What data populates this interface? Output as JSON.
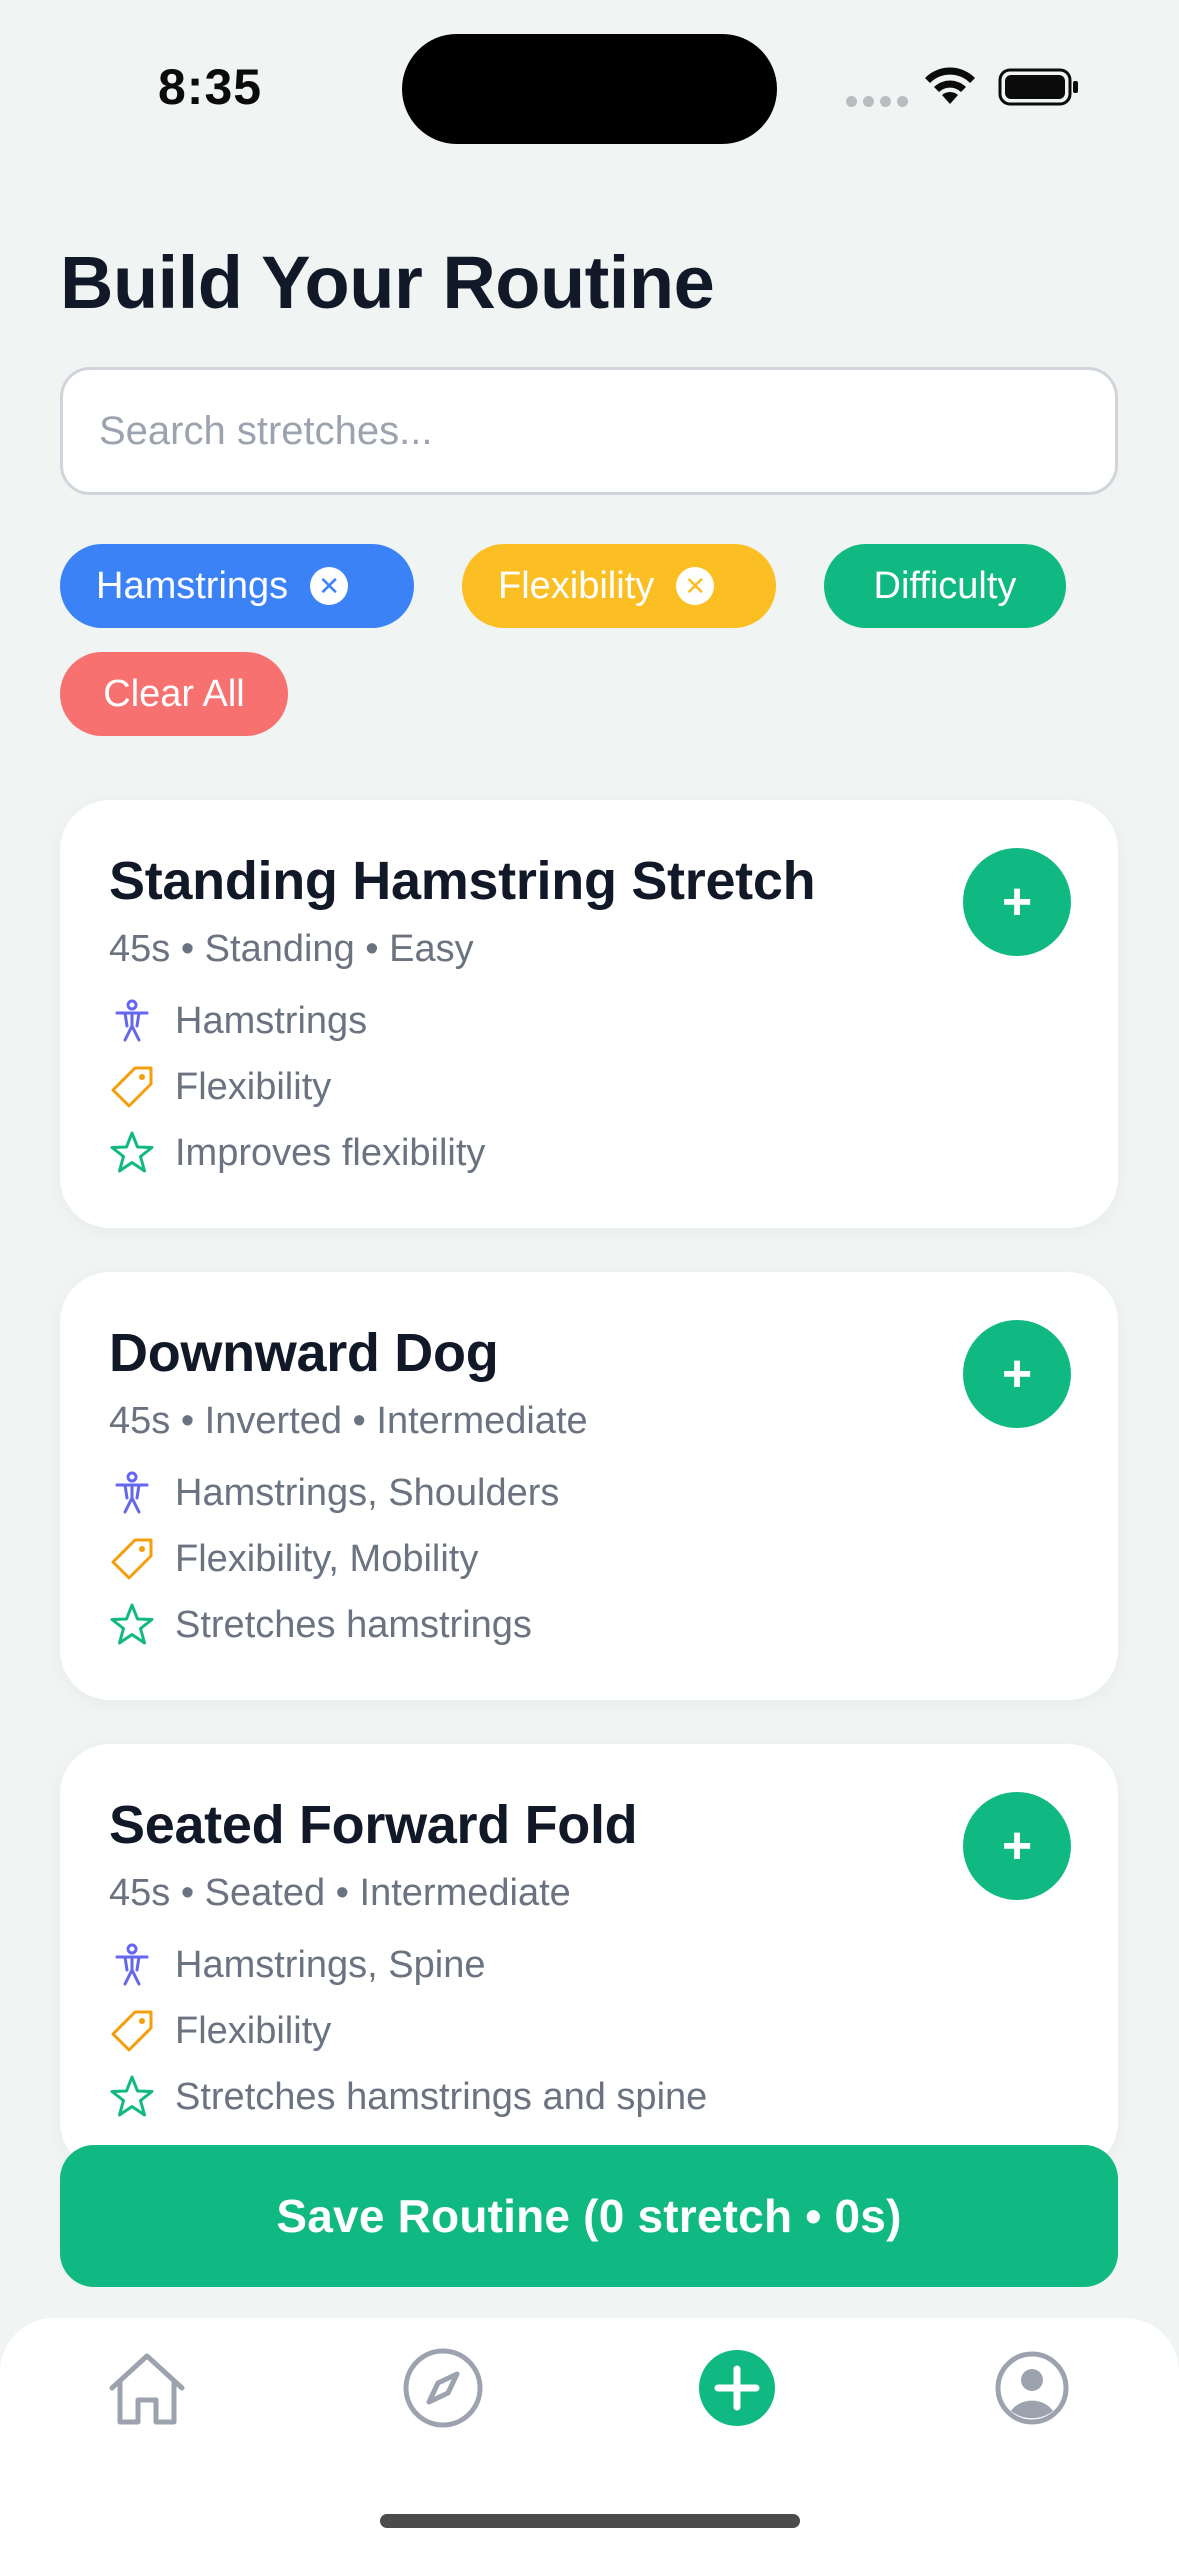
{
  "status_bar": {
    "time": "8:35"
  },
  "page": {
    "title": "Build Your Routine"
  },
  "search": {
    "placeholder": "Search stretches...",
    "value": ""
  },
  "filters": {
    "chips": [
      {
        "label": "Hamstrings",
        "color": "#3b82f6",
        "removable": true
      },
      {
        "label": "Flexibility",
        "color": "#fbbf24",
        "removable": true
      },
      {
        "label": "Difficulty",
        "color": "#10b981",
        "removable": false
      }
    ],
    "clear_all": {
      "label": "Clear All",
      "color": "#f87171"
    }
  },
  "stretches": [
    {
      "title": "Standing Hamstring Stretch",
      "meta": "45s • Standing • Easy",
      "muscles": "Hamstrings",
      "tags": "Flexibility",
      "benefit": "Improves flexibility",
      "add_label": "+"
    },
    {
      "title": "Downward Dog",
      "meta": "45s • Inverted • Intermediate",
      "muscles": "Hamstrings, Shoulders",
      "tags": "Flexibility, Mobility",
      "benefit": "Stretches hamstrings",
      "add_label": "+"
    },
    {
      "title": "Seated Forward Fold",
      "meta": "45s • Seated • Intermediate",
      "muscles": "Hamstrings, Spine",
      "tags": "Flexibility",
      "benefit": "Stretches hamstrings and spine",
      "add_label": "+"
    }
  ],
  "save_button": {
    "label": "Save Routine (0 stretch • 0s)"
  },
  "tab_bar": {
    "items": [
      {
        "icon": "home-icon",
        "active": false
      },
      {
        "icon": "compass-icon",
        "active": false
      },
      {
        "icon": "plus-circle-icon",
        "active": true
      },
      {
        "icon": "profile-icon",
        "active": false
      }
    ]
  },
  "colors": {
    "accent": "#10b981",
    "background": "#f0f4f3",
    "muscle_icon": "#6366f1",
    "tag_icon": "#f59e0b",
    "benefit_icon": "#10b981"
  }
}
